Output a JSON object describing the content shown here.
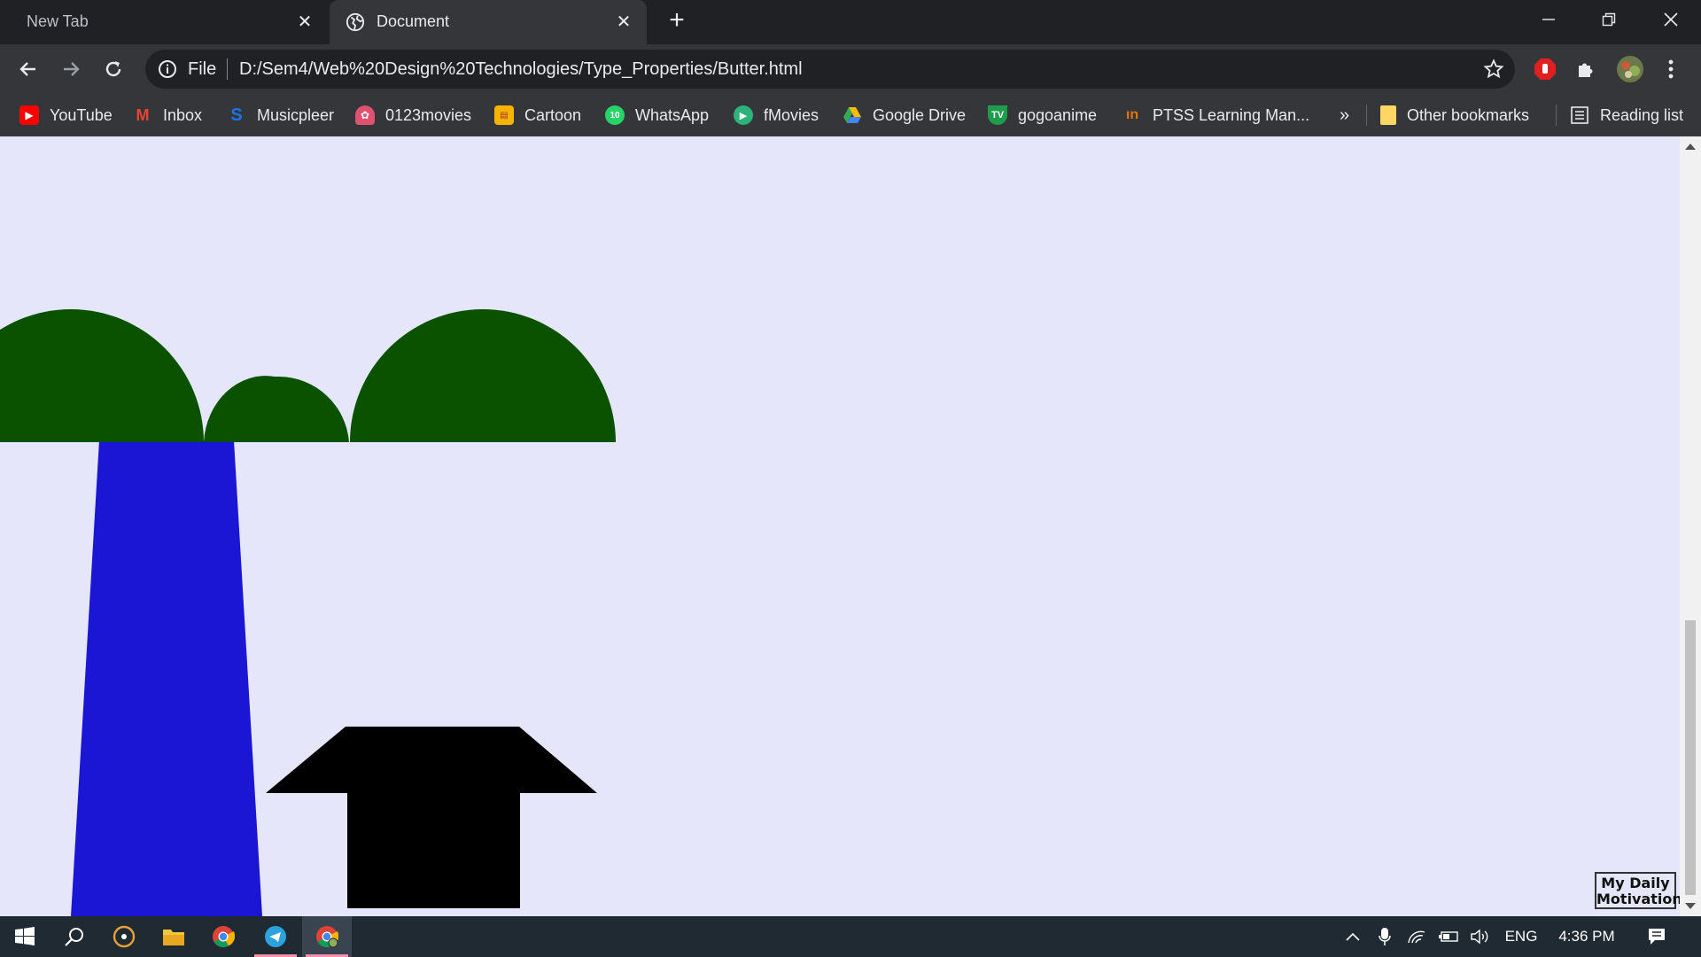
{
  "browser": {
    "tabs": [
      {
        "title": "New Tab",
        "active": false
      },
      {
        "title": "Document",
        "active": true
      }
    ],
    "new_tab_symbol": "+",
    "close_symbol": "✕",
    "address": {
      "scheme_label": "File",
      "url": "D:/Sem4/Web%20Design%20Technologies/Type_Properties/Butter.html"
    },
    "bookmarks": [
      {
        "label": "YouTube",
        "icon": "youtube-icon",
        "color": "#ff0000"
      },
      {
        "label": "Inbox",
        "icon": "gmail-icon",
        "color": "#ea4335"
      },
      {
        "label": "Musicpleer",
        "icon": "musicpleer-icon",
        "color": "#1a73e8"
      },
      {
        "label": "0123movies",
        "icon": "movies-icon",
        "color": "#e05070"
      },
      {
        "label": "Cartoon",
        "icon": "cartoon-icon",
        "color": "#f4b400"
      },
      {
        "label": "WhatsApp",
        "icon": "whatsapp-icon",
        "color": "#25d366"
      },
      {
        "label": "fMovies",
        "icon": "fmovies-icon",
        "color": "#2bb37a"
      },
      {
        "label": "Google Drive",
        "icon": "drive-icon",
        "color": "#fbbc04"
      },
      {
        "label": "gogoanime",
        "icon": "gogoanime-icon",
        "color": "#1e9e4a"
      },
      {
        "label": "PTSS Learning Man...",
        "icon": "ptss-icon",
        "color": "#e37400"
      }
    ],
    "overflow_label": "»",
    "other_bookmarks": "Other bookmarks",
    "reading_list": "Reading list"
  },
  "page": {
    "background": "#e6e6fa",
    "scene": {
      "moon_color": "#ffff00",
      "tree_canopy_color": "#0a5200",
      "trunk_color": "#1a16d4",
      "house_color": "#000000"
    },
    "badge": {
      "line1": "My Daily",
      "line2": "Motivation"
    }
  },
  "taskbar": {
    "language": "ENG",
    "time": "4:36 PM",
    "accent": "#f28fad"
  }
}
